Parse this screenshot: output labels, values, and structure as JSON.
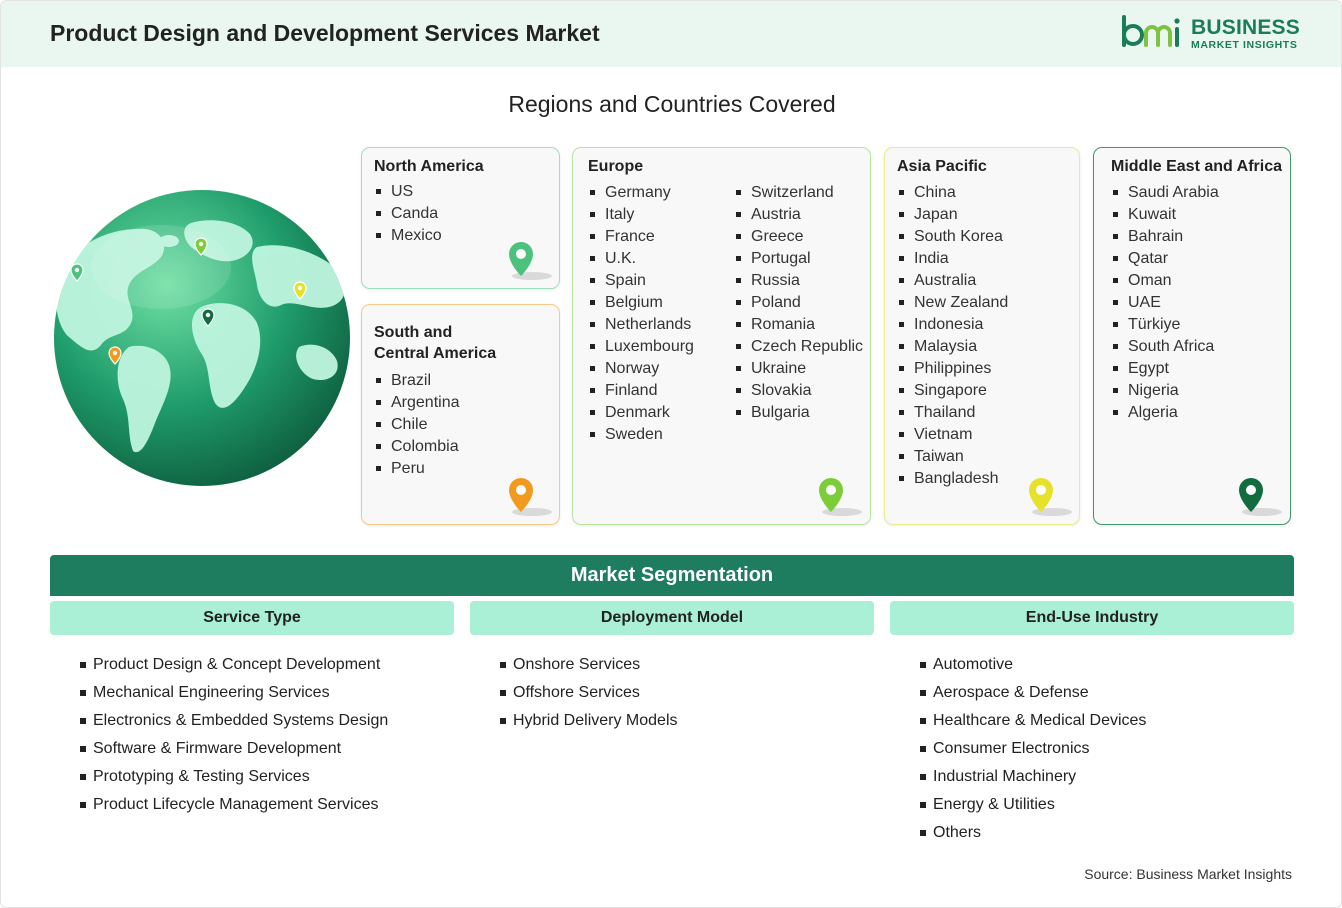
{
  "header": {
    "title": "Product Design and Development Services Market"
  },
  "logo": {
    "line1": "BUSINESS",
    "line2": "MARKET INSIGHTS"
  },
  "regions": {
    "title": "Regions and Countries Covered",
    "north_america": {
      "name": "North America",
      "countries": [
        "US",
        "Canda",
        "Mexico"
      ],
      "pin_color": "#4cc27c"
    },
    "south_america": {
      "name_line1": "South and",
      "name_line2": "Central America",
      "countries": [
        "Brazil",
        "Argentina",
        "Chile",
        "Colombia",
        "Peru"
      ],
      "pin_color": "#f29a1e"
    },
    "europe": {
      "name": "Europe",
      "countries_col1": [
        "Germany",
        "Italy",
        "France",
        "U.K.",
        "Spain",
        "Belgium",
        "Netherlands",
        "Luxembourg",
        "Norway",
        "Finland",
        "Denmark",
        "Sweden"
      ],
      "countries_col2": [
        "Switzerland",
        "Austria",
        "Greece",
        "Portugal",
        "Russia",
        "Poland",
        "Romania",
        "Czech Republic",
        "Ukraine",
        "Slovakia",
        "Bulgaria"
      ],
      "pin_color": "#7dcc3a"
    },
    "asia_pacific": {
      "name": "Asia Pacific",
      "countries": [
        "China",
        "Japan",
        "South Korea",
        "India",
        "Australia",
        "New Zealand",
        "Indonesia",
        "Malaysia",
        "Philippines",
        "Singapore",
        "Thailand",
        "Vietnam",
        "Taiwan",
        "Bangladesh"
      ],
      "pin_color": "#e6e22b"
    },
    "mea": {
      "name": "Middle East and Africa",
      "countries": [
        "Saudi Arabia",
        "Kuwait",
        "Bahrain",
        "Qatar",
        "Oman",
        "UAE",
        "Türkiye",
        "South Africa",
        "Egypt",
        "Nigeria",
        "Algeria"
      ],
      "pin_color": "#136c3f"
    }
  },
  "segmentation": {
    "title": "Market Segmentation",
    "columns": [
      {
        "heading": "Service Type",
        "items": [
          "Product Design & Concept Development",
          "Mechanical Engineering Services",
          "Electronics & Embedded Systems Design",
          "Software & Firmware Development",
          "Prototyping & Testing Services",
          "Product Lifecycle Management Services"
        ]
      },
      {
        "heading": "Deployment Model",
        "items": [
          "Onshore Services",
          "Offshore Services",
          "Hybrid Delivery Models"
        ]
      },
      {
        "heading": "End-Use Industry",
        "items": [
          "Automotive",
          "Aerospace & Defense",
          "Healthcare & Medical Devices",
          "Consumer Electronics",
          "Industrial Machinery",
          "Energy & Utilities",
          "Others"
        ]
      }
    ]
  },
  "source": "Source: Business Market Insights",
  "colors": {
    "accent": "#1e7d5e",
    "header_bg": "#e9f7f0",
    "seg_head_bg": "#a9f0d6"
  }
}
